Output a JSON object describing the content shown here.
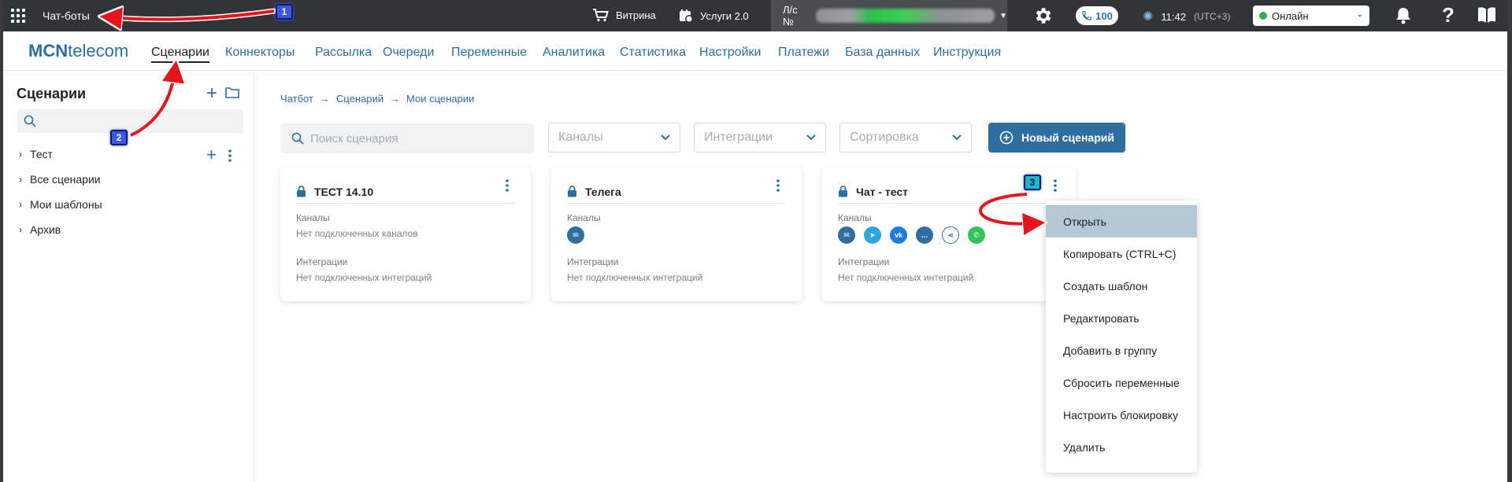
{
  "topbar": {
    "app_title": "Чат-боты",
    "vitrina_label": "Витрина",
    "services_label": "Услуги 2.0",
    "account_label": "Л/с №",
    "phone_count": "100",
    "time": "11:42",
    "timezone": "(UTC+3)",
    "status_value": "Онлайн",
    "help_label": "?"
  },
  "logo": {
    "bold": "MCN",
    "rest": "telecom"
  },
  "nav": [
    {
      "label": "Сценарии",
      "active": true
    },
    {
      "label": "Коннекторы"
    },
    {
      "label": "Рассылка"
    },
    {
      "label": "Очереди"
    },
    {
      "label": "Переменные"
    },
    {
      "label": "Аналитика"
    },
    {
      "label": "Статистика"
    },
    {
      "label": "Настройки"
    },
    {
      "label": "Платежи"
    },
    {
      "label": "База данных"
    },
    {
      "label": "Инструкция"
    }
  ],
  "sidebar": {
    "title": "Сценарии",
    "items": [
      {
        "label": "Тест"
      },
      {
        "label": "Все сценарии"
      },
      {
        "label": "Мои шаблоны"
      },
      {
        "label": "Архив"
      }
    ]
  },
  "breadcrumb": [
    "Чатбот",
    "Сценарий",
    "Мои сценарии"
  ],
  "filters": {
    "search_placeholder": "Поиск сценария",
    "channels": "Каналы",
    "integrations": "Интеграции",
    "sort": "Сортировка",
    "new_button": "Новый сценарий"
  },
  "cards": [
    {
      "title": "ТЕСТ 14.10",
      "channels_label": "Каналы",
      "channels_text": "Нет подключенных каналов",
      "integrations_label": "Интеграции",
      "integrations_text": "Нет подключенных интеграций"
    },
    {
      "title": "Телега",
      "channels_label": "Каналы",
      "channels_icons": [
        "mail-icon"
      ],
      "integrations_label": "Интеграции",
      "integrations_text": "Нет подключенных интеграций"
    },
    {
      "title": "Чат - тест",
      "channels_label": "Каналы",
      "channels_icons": [
        "mail-icon",
        "telegram-icon",
        "vk-icon",
        "chat-icon",
        "share-icon",
        "whatsapp-icon"
      ],
      "integrations_label": "Интеграции",
      "integrations_text": "Нет подключенных интеграций"
    }
  ],
  "context_menu": [
    {
      "label": "Открыть",
      "highlighted": true
    },
    {
      "label": "Копировать (CTRL+C)"
    },
    {
      "label": "Создать шаблон"
    },
    {
      "label": "Редактировать"
    },
    {
      "label": "Добавить в группу"
    },
    {
      "label": "Сбросить переменные"
    },
    {
      "label": "Настроить блокировку"
    },
    {
      "label": "Удалить"
    }
  ],
  "annotations": [
    {
      "number": "1"
    },
    {
      "number": "2"
    },
    {
      "number": "3"
    }
  ],
  "colors": {
    "topbar_bg": "#313438",
    "accent": "#2a6f9e",
    "primary_button": "#2f6fa0",
    "menu_highlight": "#b3c8d4",
    "annotation_arrow": "#e8141b",
    "online_dot": "#2bb24c"
  }
}
